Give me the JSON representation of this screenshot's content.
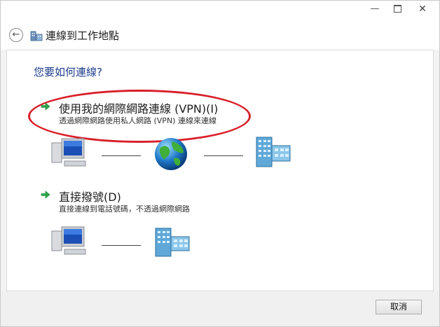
{
  "window": {
    "title": "",
    "minimize_glyph": "—",
    "close_glyph": "✕"
  },
  "nav": {
    "back_glyph": "←",
    "title": "連線到工作地點"
  },
  "main": {
    "question": "您要如何連線?",
    "options": [
      {
        "title": "使用我的網際網路連線 (VPN)(I)",
        "description": "透過網際網路使用私人網路 (VPN) 連線來連線",
        "icon": "green-arrow-icon"
      },
      {
        "title": "直接撥號(D)",
        "description": "直接連線到電話號碼，不透過網際網路",
        "icon": "green-arrow-icon"
      }
    ],
    "annotation_color": "#d8202a"
  },
  "footer": {
    "cancel_label": "取消"
  }
}
